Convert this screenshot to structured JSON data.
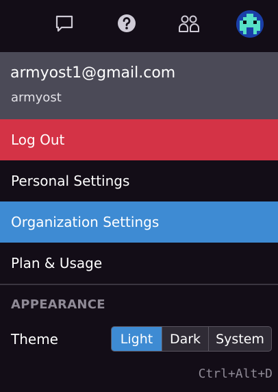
{
  "topbar": {
    "icons": [
      "chat-icon",
      "help-icon",
      "users-icon"
    ],
    "avatar": "avatar"
  },
  "user": {
    "email": "armyost1@gmail.com",
    "username": "armyost"
  },
  "menu": {
    "logout": "Log Out",
    "personal_settings": "Personal Settings",
    "organization_settings": "Organization Settings",
    "plan_usage": "Plan & Usage"
  },
  "appearance": {
    "section_label": "APPEARANCE",
    "theme_label": "Theme",
    "theme_options": [
      "Light",
      "Dark",
      "System"
    ],
    "selected": "Light"
  },
  "shortcut": "Ctrl+Alt+D",
  "colors": {
    "background": "#130d17",
    "user_header": "#4b4a57",
    "logout": "#d43346",
    "highlight": "#3e8bd3",
    "muted_text": "#8f8a96"
  }
}
